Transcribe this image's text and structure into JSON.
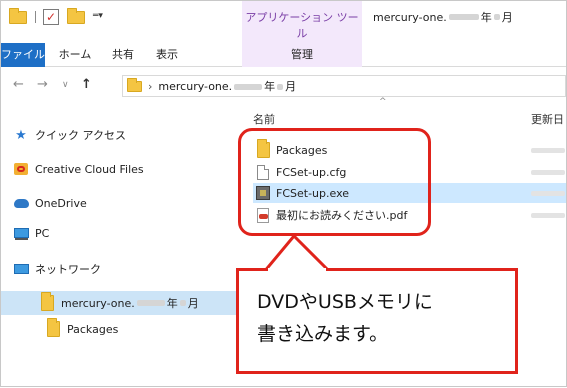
{
  "titlebar": {
    "app_tools_label": "アプリケーション ツール",
    "window_title_prefix": "mercury-one.",
    "window_title_mid": "年",
    "window_title_suffix": "月"
  },
  "tabs": {
    "file": "ファイル",
    "home": "ホーム",
    "share": "共有",
    "view": "表示",
    "manage": "管理"
  },
  "address": {
    "path_prefix": "mercury-one.",
    "path_mid": "年",
    "path_suffix": "月"
  },
  "nav_pane": {
    "quick_access": "クイック アクセス",
    "creative_cloud": "Creative Cloud Files",
    "onedrive": "OneDrive",
    "pc": "PC",
    "network": "ネットワーク",
    "current_prefix": "mercury-one.",
    "current_mid": "年",
    "current_suffix": "月",
    "packages": "Packages"
  },
  "file_list": {
    "col_name": "名前",
    "col_date": "更新日",
    "rows": [
      {
        "name": "Packages"
      },
      {
        "name": "FCSet-up.cfg"
      },
      {
        "name": "FCSet-up.exe"
      },
      {
        "name": "最初にお読みください.pdf"
      }
    ]
  },
  "callout": {
    "line1": "DVDやUSBメモリに",
    "line2": "書き込みます。"
  },
  "colors": {
    "accent_blue": "#1e6fc6",
    "app_tools_bg": "#f3e8fb",
    "annotation_red": "#e0231b",
    "selection": "#cde8ff"
  }
}
